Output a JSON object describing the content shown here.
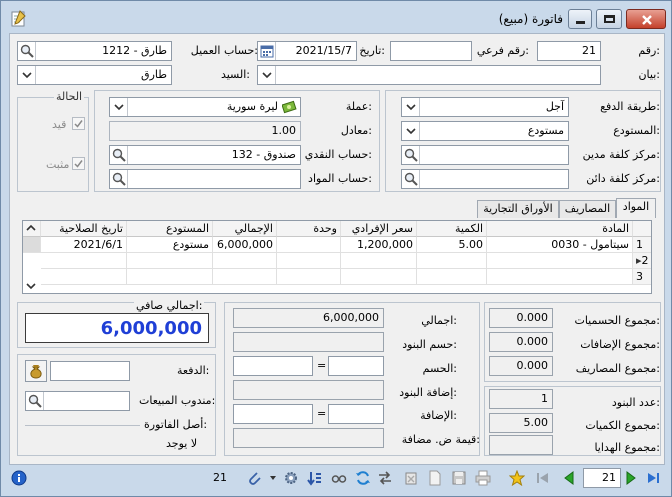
{
  "window": {
    "title": "فاتورة (مبيع)"
  },
  "header": {
    "number_label": "رقم:",
    "number_value": "21",
    "subnumber_label": "رقم فرعي:",
    "subnumber_value": "",
    "date_label": "تاريخ:",
    "date_value": "2021/15/7",
    "customer_label": "حساب العميل:",
    "customer_value": "1212 - طارق",
    "statement_label": "بيان:",
    "statement_value": "",
    "mr_label": "السيد:",
    "mr_value": "طارق"
  },
  "payment": {
    "method_label": "طريقة الدفع:",
    "method_value": "آجل",
    "warehouse_label": "المستودع:",
    "warehouse_value": "مستودع",
    "debit_center_label": "مركز كلفة مدين:",
    "debit_center_value": "",
    "credit_center_label": "مركز كلفة دائن:",
    "credit_center_value": ""
  },
  "currency": {
    "currency_label": "عملة:",
    "currency_value": "ليرة سورية",
    "rate_label": "معادل:",
    "rate_value": "1.00",
    "cash_account_label": "حساب النقدي:",
    "cash_account_value": "132 - صندوق",
    "materials_account_label": "حساب المواد:",
    "materials_account_value": ""
  },
  "status_group": {
    "title": "الحالة",
    "posted_label": "قيد",
    "fixed_label": "مثبت"
  },
  "tabs": [
    "المواد",
    "المصاريف",
    "الأوراق التجارية"
  ],
  "grid": {
    "columns": [
      "المادة",
      "الكمية",
      "سعر الإفرادي",
      "وحدة",
      "الإجمالي",
      "المستودع",
      "تاريخ الصلاحية"
    ],
    "rows": [
      {
        "index": "1",
        "material": "0030 - سيتامول",
        "qty": "5.00",
        "price": "1,200,000",
        "unit": "",
        "total": "6,000,000",
        "warehouse": "مستودع",
        "expiry": "2021/6/1"
      }
    ],
    "row_numbers": [
      "2",
      "3"
    ]
  },
  "totals": {
    "net_label": "اجمالي صافي:",
    "net_value": "6,000,000",
    "total_label": "اجمالي:",
    "total_value": "6,000,000",
    "items_discount_label": "حسم البنود:",
    "items_discount_value": "",
    "discount_label": "الحسم:",
    "items_addition_label": "إضافة البنود:",
    "items_addition_value": "",
    "addition_label": "الإضافة:",
    "vat_label": "قيمة ض. مضافة:",
    "vat_value": "",
    "equals": "=",
    "discounts_sum_label": "مجموع الحسميات:",
    "discounts_sum_value": "0.000",
    "additions_sum_label": "مجموع الإضافات:",
    "additions_sum_value": "0.000",
    "expenses_sum_label": "مجموع المصاريف:",
    "expenses_sum_value": "0.000",
    "items_count_label": "عدد البنود:",
    "items_count_value": "1",
    "qty_sum_label": "مجموع الكميات:",
    "qty_sum_value": "5.00",
    "gifts_sum_label": "مجموع الهدايا:",
    "gifts_sum_value": ""
  },
  "left_panel": {
    "paid_label": "الدفعة:",
    "paid_value": "",
    "sales_rep_label": "مندوب المبيعات:",
    "sales_rep_value": "",
    "origin_label": "أصل الفاتورة:",
    "origin_value": "لا يوجد"
  },
  "statusbar": {
    "record_count": "21",
    "current_page": "21"
  },
  "colors": {
    "accent": "#1f3fd6",
    "window": "#c9d9ea",
    "panel": "#f0f0f0"
  }
}
